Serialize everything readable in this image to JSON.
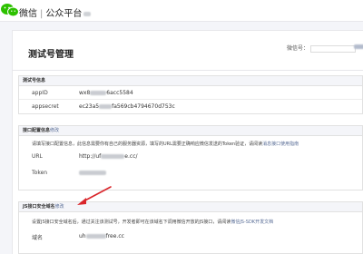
{
  "header": {
    "brand_prefix": "微信",
    "separator": "|",
    "brand_suffix": "公众平台"
  },
  "page": {
    "title": "测试号管理",
    "account_label": "微信号："
  },
  "test_info": {
    "heading": "测试号信息",
    "rows": [
      {
        "key": "appID",
        "value_start": "wx8",
        "value_end": "6acc5584"
      },
      {
        "key": "appsecret",
        "value_start": "ec23a5",
        "value_end": "fa569cb4794670d753c"
      }
    ]
  },
  "interface_config": {
    "heading": "接口配置信息",
    "heading_link": "修改",
    "description": "请填写接口配置信息，此信息需要你有自己的服务器资源，填写的URL需要正确响应微信发送的Token验证，请阅读",
    "description_link": "消息接口使用指南",
    "url_key": "URL",
    "url_start": "http://uf",
    "url_end": "e.cc/",
    "token_key": "Token"
  },
  "js_domain": {
    "heading": "JS接口安全域名",
    "heading_link": "修改",
    "description": "设置JS接口安全域名后，通过关注该测试号，开发者即可在该域名下调用微信开放的JS接口，请阅读",
    "description_link": "微信JS-SDK开发文档",
    "domain_key": "域名",
    "domain_start": "uh",
    "domain_end": "free.cc"
  },
  "colors": {
    "link": "#576b95",
    "arrow": "#d9262b",
    "logo": "#2dc100"
  }
}
